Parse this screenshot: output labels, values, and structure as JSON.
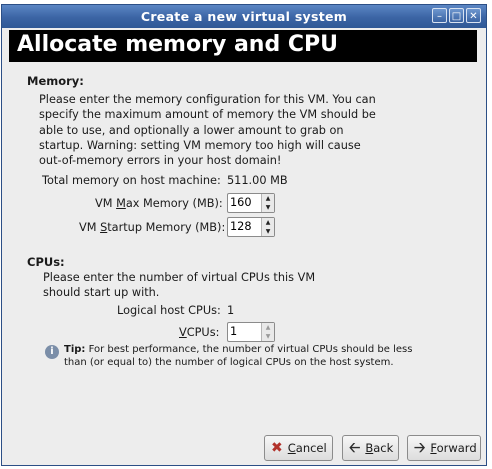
{
  "window": {
    "title": "Create a new virtual system"
  },
  "header": {
    "title": "Allocate memory and CPU"
  },
  "memory": {
    "section_title": "Memory:",
    "description": "Please enter the memory configuration for this VM. You can specify the maximum amount of memory the VM should be able to use, and optionally a lower amount to grab on startup. Warning: setting VM memory too high will cause out-of-memory errors in your host domain!",
    "total_label": "Total memory on host machine:",
    "total_value": "511.00 MB",
    "max_label_pre": "VM ",
    "max_label_mnemonic": "M",
    "max_label_post": "ax Memory (MB):",
    "max_value": "160",
    "startup_label_pre": "VM ",
    "startup_label_mnemonic": "S",
    "startup_label_post": "tartup Memory (MB):",
    "startup_value": "128"
  },
  "cpus": {
    "section_title": "CPUs:",
    "description": "Please enter the number of virtual CPUs this VM should start up with.",
    "logical_label": "Logical host CPUs:",
    "logical_value": "1",
    "vcpus_label_mnemonic": "V",
    "vcpus_label_post": "CPUs:",
    "vcpus_value": "1"
  },
  "tip": {
    "label": "Tip:",
    "text": " For best performance, the number of virtual CPUs should be less than (or equal to) the number of logical CPUs on the host system."
  },
  "buttons": {
    "cancel_mnemonic": "C",
    "cancel_rest": "ancel",
    "back_mnemonic": "B",
    "back_rest": "ack",
    "forward_mnemonic": "F",
    "forward_rest": "orward"
  },
  "icons": {
    "minimize": "minimize-icon",
    "maximize": "maximize-icon",
    "close": "close-icon",
    "info": "info-icon"
  },
  "colors": {
    "titlebar": "#3b64a4",
    "header_bg": "#000000",
    "window_bg": "#ededed"
  }
}
